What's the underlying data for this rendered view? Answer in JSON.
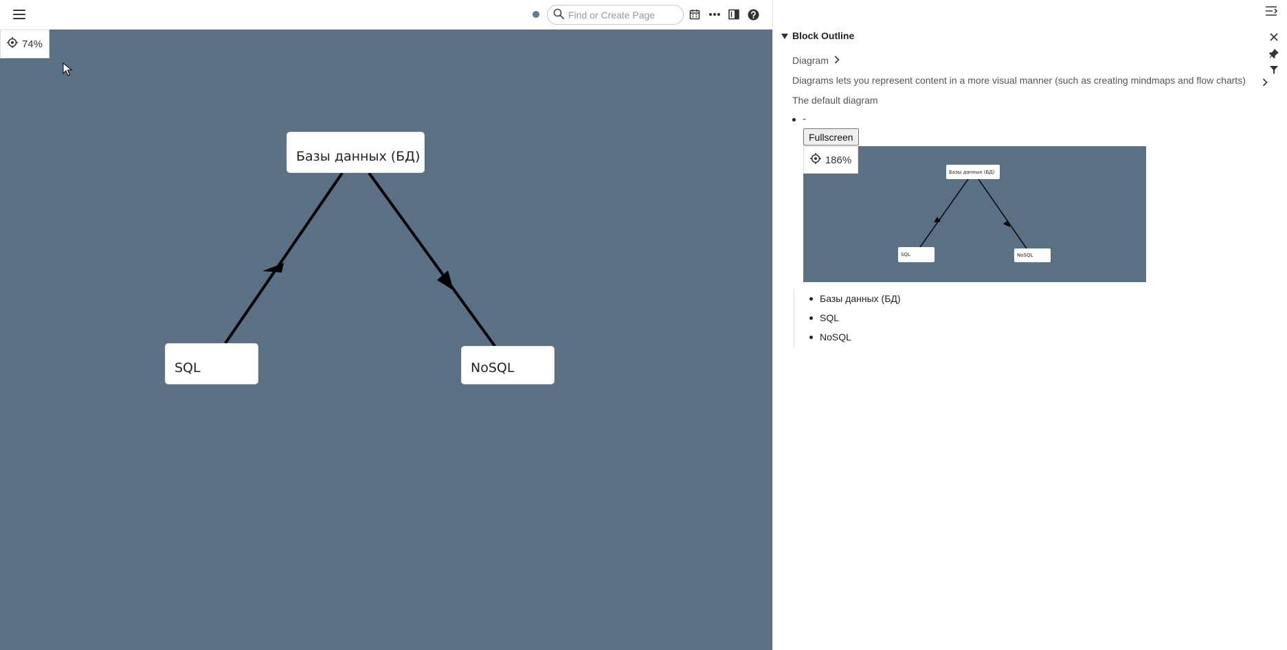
{
  "topbar": {
    "search_placeholder": "Find or Create Page"
  },
  "canvas": {
    "zoom": "74%",
    "nodes": {
      "root": "Базы данных (БД)",
      "left": "SQL",
      "right": "NoSQL"
    }
  },
  "sidebar": {
    "title": "Block Outline",
    "breadcrumb": "Diagram",
    "description": "Diagrams lets you represent content in a more visual manner (such as creating mindmaps and flow charts)",
    "default_label": "The default diagram",
    "bullet": "-",
    "fullscreen_label": "Fullscreen",
    "mini_zoom": "186%",
    "outline_items": [
      "Базы данных (БД)",
      "SQL",
      "NoSQL"
    ]
  },
  "colors": {
    "canvas_bg": "#5a7085",
    "accent_dot": "#647a8d"
  }
}
